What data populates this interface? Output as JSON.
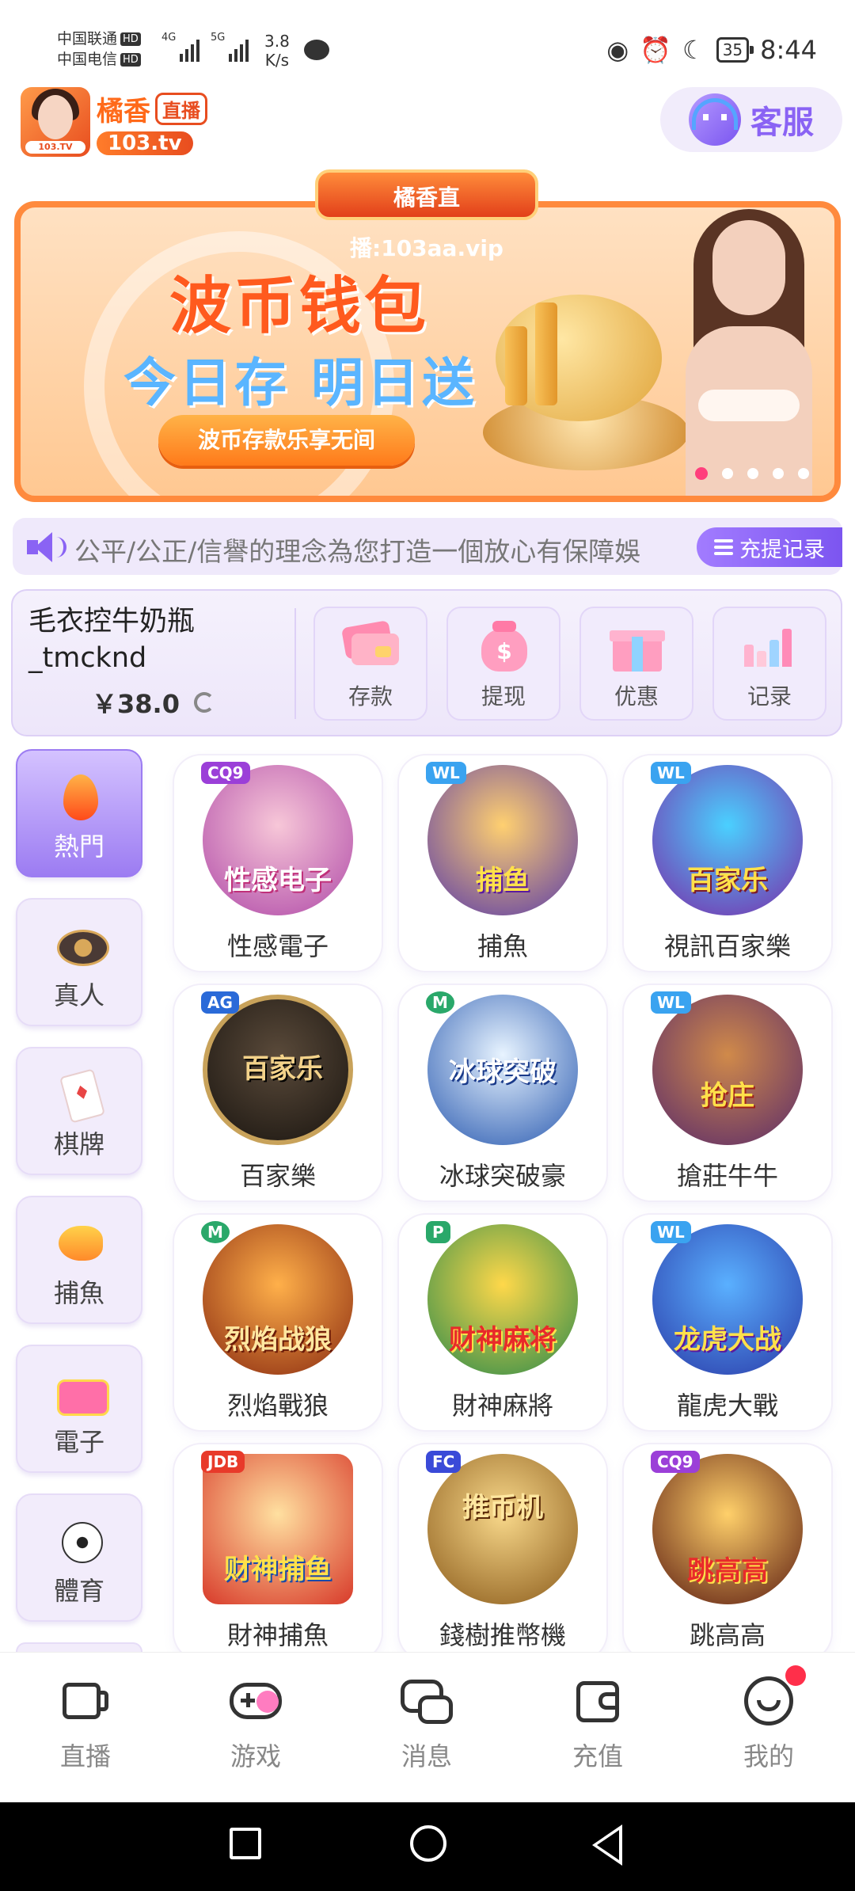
{
  "status_bar": {
    "carrier1": "中国联通",
    "carrier2": "中国电信",
    "hd": "HD",
    "net1": "4G",
    "net2": "5G",
    "speed_value": "3.8",
    "speed_unit": "K/s",
    "battery": "35",
    "time": "8:44"
  },
  "header": {
    "logo_name": "橘香",
    "logo_live": "直播",
    "logo_url": "103.tv",
    "logo_avatar_label": "103.TV",
    "service_label": "客服"
  },
  "banner": {
    "tag": "橘香直播:103aa.vip",
    "title": "波币钱包",
    "subtitle": "今日存 明日送",
    "button": "波币存款乐享无间",
    "slide_count": 5,
    "active_slide": 0
  },
  "marquee": {
    "text": "公平/公正/信譽的理念為您打造一個放心有保障娛",
    "record_button": "充提记录"
  },
  "account": {
    "username": "毛衣控牛奶瓶_tmcknd",
    "balance": "￥38.0",
    "actions": [
      {
        "label": "存款",
        "icon": "deposit-card-icon"
      },
      {
        "label": "提现",
        "icon": "money-bag-icon"
      },
      {
        "label": "优惠",
        "icon": "gift-icon"
      },
      {
        "label": "记录",
        "icon": "bar-chart-icon"
      }
    ]
  },
  "categories": [
    {
      "label": "熱門",
      "icon": "flame-icon",
      "active": true
    },
    {
      "label": "真人",
      "icon": "casino-chip-icon"
    },
    {
      "label": "棋牌",
      "icon": "playing-card-icon"
    },
    {
      "label": "捕魚",
      "icon": "fish-icon"
    },
    {
      "label": "電子",
      "icon": "slot-machine-icon"
    },
    {
      "label": "體育",
      "icon": "soccer-ball-icon"
    }
  ],
  "games": [
    {
      "name": "性感電子",
      "brand": "CQ9",
      "art_text": "性感电子"
    },
    {
      "name": "捕魚",
      "brand": "WL",
      "art_text": "捕鱼"
    },
    {
      "name": "視訊百家樂",
      "brand": "WL",
      "art_text": "百家乐"
    },
    {
      "name": "百家樂",
      "brand": "AG",
      "art_text": "百家乐"
    },
    {
      "name": "冰球突破豪",
      "brand": "M",
      "art_text": "冰球突破"
    },
    {
      "name": "搶莊牛牛",
      "brand": "WL",
      "art_text": "抢庄"
    },
    {
      "name": "烈焰戰狼",
      "brand": "M",
      "art_text": "烈焰战狼"
    },
    {
      "name": "財神麻將",
      "brand": "P",
      "art_text": "财神麻将"
    },
    {
      "name": "龍虎大戰",
      "brand": "WL",
      "art_text": "龙虎大战"
    },
    {
      "name": "財神捕魚",
      "brand": "JDB",
      "art_text": "财神捕鱼"
    },
    {
      "name": "錢樹推幣機",
      "brand": "FC",
      "art_text": "推币机"
    },
    {
      "name": "跳高高",
      "brand": "CQ9",
      "art_text": "跳高高"
    }
  ],
  "bottom_nav": [
    {
      "label": "直播",
      "icon": "video-camera-icon"
    },
    {
      "label": "游戏",
      "icon": "gamepad-icon"
    },
    {
      "label": "消息",
      "icon": "message-icon"
    },
    {
      "label": "充值",
      "icon": "wallet-icon"
    },
    {
      "label": "我的",
      "icon": "profile-smile-icon"
    }
  ],
  "colors": {
    "accent": "#8a63f4",
    "banner_orange": "#ff8a3d",
    "notification": "#ff2f4a"
  }
}
